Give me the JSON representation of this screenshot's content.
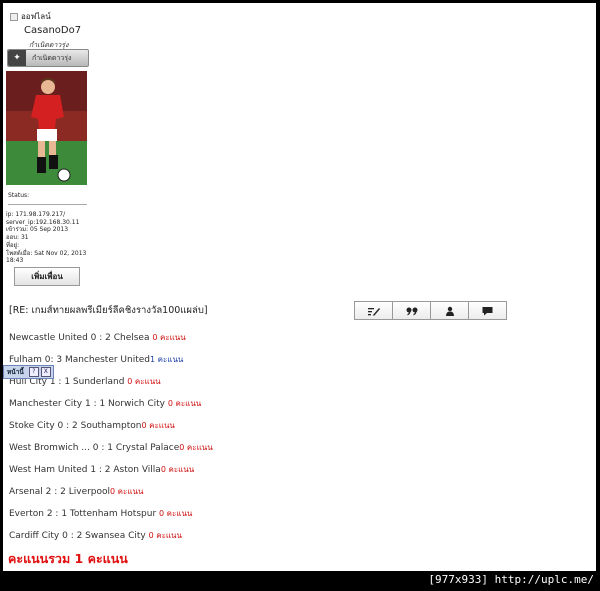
{
  "sidebar": {
    "online_status": "ออฟไลน์",
    "username": "CasanoDo7",
    "user_title": "กำเนิดดาวรุ่ง",
    "rank_label": "กำเนิดดาวรุ่ง",
    "status_label": "Status:",
    "meta_lines": [
      "ip: 171.98.179.217/",
      "server_ip:192.168.30.11",
      "เข้าร่วม: 05 Sep 2013",
      "ออบ: 31",
      "ที่อยู่:",
      "โพสต์เมื่อ: Sat Nov 02, 2013",
      "18:43"
    ],
    "add_friend_label": "เพิ่มเพื่อน"
  },
  "post": {
    "title": "[RE: เกมส์ทายผลพรีเมียร์ลีคชิงรางวัล100แผล่บ]",
    "toolbar": [
      {
        "icon": "edit-icon",
        "glyph": "✎"
      },
      {
        "icon": "quote-icon",
        "glyph": "❞"
      },
      {
        "icon": "profile-icon",
        "glyph": "●"
      },
      {
        "icon": "message-icon",
        "glyph": "▬"
      }
    ],
    "results": [
      {
        "match": "Newcastle United 0 : 2 Chelsea ",
        "score": "0 คะแนน",
        "color": "#d01010"
      },
      {
        "match": "Fulham 0: 3 Manchester United",
        "score": "1 คะแนน",
        "color": "#1a3fa8"
      },
      {
        "match": "Hull City 1 : 1 Sunderland ",
        "score": "0 คะแนน",
        "color": "#d01010"
      },
      {
        "match": "Manchester City 1 : 1 Norwich City ",
        "score": "0 คะแนน",
        "color": "#d01010"
      },
      {
        "match": "Stoke City 0 : 2 Southampton",
        "score": "0 คะแนน",
        "color": "#d01010"
      },
      {
        "match": "West Bromwich ... 0 : 1 Crystal Palace",
        "score": "0 คะแนน",
        "color": "#d01010"
      },
      {
        "match": "West Ham United 1 : 2 Aston Villa",
        "score": "0 คะแนน",
        "color": "#d01010"
      },
      {
        "match": "Arsenal 2 : 2 Liverpool",
        "score": "0 คะแนน",
        "color": "#d01010"
      },
      {
        "match": "Everton 2 : 1 Tottenham Hotspur ",
        "score": "0 คะแนน",
        "color": "#d01010"
      },
      {
        "match": "Cardiff City 0 : 2 Swansea City ",
        "score": "0 คะแนน",
        "color": "#d01010"
      }
    ],
    "total": "คะแนนรวม 1 คะแนน"
  },
  "page_widget": {
    "label": "หน้านี้",
    "help": "?",
    "close": "X"
  },
  "watermark": "[977x933] http://uplc.me/"
}
